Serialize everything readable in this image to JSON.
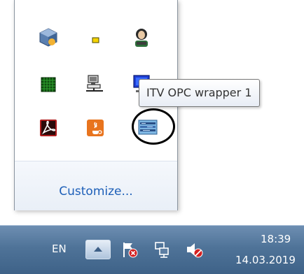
{
  "popup": {
    "icons": [
      {
        "name": "virtualbox-cube-icon"
      },
      {
        "name": "small-yellow-icon"
      },
      {
        "name": "person-icon"
      },
      {
        "name": "green-grid-icon"
      },
      {
        "name": "network-computer-icon"
      },
      {
        "name": "monitor-icon"
      },
      {
        "name": "adobe-acrobat-icon"
      },
      {
        "name": "java-icon"
      },
      {
        "name": "itv-opc-wrapper-icon"
      }
    ],
    "customize_label": "Customize..."
  },
  "tooltip": {
    "text": "ITV OPC wrapper 1"
  },
  "taskbar": {
    "language": "EN",
    "clock_time": "18:39",
    "clock_date": "14.03.2019"
  }
}
